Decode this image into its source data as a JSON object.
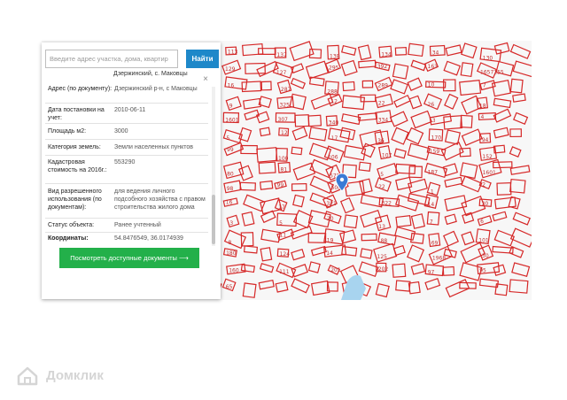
{
  "search": {
    "placeholder": "Введите адрес участка, дома, квартир",
    "button_label": "Найти"
  },
  "suggestion": "Дзержинский, с. Маковцы",
  "details": [
    {
      "label": "Адрес (по документу):",
      "value": "Дзержинский р-н, с Маковцы"
    },
    {
      "label": "Дата постановки на учет:",
      "value": "2010-06-11"
    },
    {
      "label": "Площадь м2:",
      "value": "3000"
    },
    {
      "label": "Категория земель:",
      "value": "Земли населенных пунктов"
    },
    {
      "label": "Кадастровая стоимость на 2016г.:",
      "value": "553290"
    },
    {
      "label": "Вид разрешенного использования (по документам):",
      "value": "для ведения личного подсобного хозяйства с правом строительства жилого дома"
    },
    {
      "label": "Статус объекта:",
      "value": "Ранее учтенный"
    },
    {
      "label": "Координаты:",
      "value": "54.8476549, 36.0174939"
    }
  ],
  "docs_button_label": "Посмотреть доступные документы ⟶",
  "map": {
    "parcel_labels": [
      "113",
      "137",
      "138",
      "134",
      "34",
      "130",
      "129",
      "127",
      "295",
      "392",
      "163",
      "1657155",
      "16",
      "287",
      "288",
      "289",
      "10",
      "7",
      "9",
      "325",
      "12",
      "22",
      "26",
      "18",
      "1601",
      "307",
      "340",
      "334",
      "3",
      "4",
      "5",
      "12",
      "17",
      "36",
      "170",
      "94",
      "99",
      "100",
      "106",
      "107",
      "159",
      "152",
      "80",
      "81",
      "578",
      "5",
      "187",
      "1601",
      "98",
      "99",
      "500",
      "22",
      "1",
      "2",
      "16",
      "17",
      "321",
      "322",
      "14",
      "30",
      "3",
      "5",
      "20",
      "13",
      "7",
      "6",
      "8",
      "11",
      "19",
      "88",
      "69",
      "101",
      "180",
      "124",
      "14",
      "125",
      "1968",
      "30",
      "160",
      "111",
      "201",
      "202",
      "97",
      "95",
      "65"
    ],
    "marker": "location-pin",
    "colors": {
      "parcel": "#d62828",
      "background": "#f7f7f7",
      "river": "#a8d4ef"
    }
  },
  "watermark": {
    "text": "Домклик",
    "icon": "house-logo-icon"
  }
}
